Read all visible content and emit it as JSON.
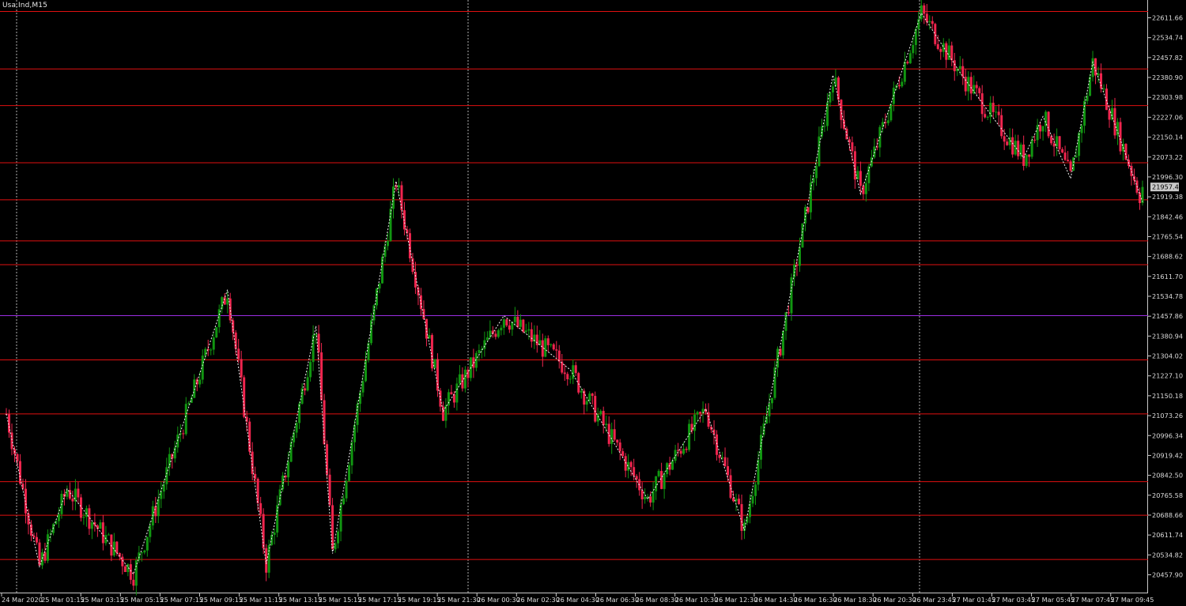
{
  "symbol": "Usa.Ind,M15",
  "colors": {
    "background": "#000000",
    "bull": "#119611",
    "bear": "#f0254e",
    "level_line": "#e01010",
    "mid_line": "#9b2ee3",
    "zigzag": "#f2f2f2",
    "grid_v": "#cfcfcf",
    "axis_text": "#dcdcdc",
    "current_price_bg": "#c8c8c8"
  },
  "current_price": "21957.40",
  "chart_data": {
    "type": "candlestick",
    "timeframe": "M15",
    "y_range": [
      20420,
      22640
    ],
    "price_ticks": [
      "22611.66",
      "22534.74",
      "22457.82",
      "22380.90",
      "22303.98",
      "22227.06",
      "22150.14",
      "22073.22",
      "21996.30",
      "21919.38",
      "21842.46",
      "21765.54",
      "21688.62",
      "21611.70",
      "21534.78",
      "21457.86",
      "21380.94",
      "21304.02",
      "21227.10",
      "21150.18",
      "21073.26",
      "20996.34",
      "20919.42",
      "20842.50",
      "20765.58",
      "20688.66",
      "20611.74",
      "20534.82",
      "20457.90"
    ],
    "time_ticks": [
      "24 Mar 2020",
      "25 Mar 01:15",
      "25 Mar 03:15",
      "25 Mar 05:15",
      "25 Mar 07:15",
      "25 Mar 09:15",
      "25 Mar 11:15",
      "25 Mar 13:15",
      "25 Mar 15:15",
      "25 Mar 17:15",
      "25 Mar 19:15",
      "25 Mar 21:30",
      "26 Mar 00:30",
      "26 Mar 02:30",
      "26 Mar 04:30",
      "26 Mar 06:30",
      "26 Mar 08:30",
      "26 Mar 10:30",
      "26 Mar 12:30",
      "26 Mar 14:30",
      "26 Mar 16:30",
      "26 Mar 18:30",
      "26 Mar 20:30",
      "26 Mar 23:45",
      "27 Mar 01:45",
      "27 Mar 03:45",
      "27 Mar 05:45",
      "27 Mar 07:45",
      "27 Mar 09:45"
    ],
    "day_separators": [
      "25 Mar 00:00",
      "26 Mar 00:00",
      "27 Mar 00:00"
    ],
    "level_lines": [
      22636,
      22414,
      22272,
      22051,
      21908,
      21749,
      21657,
      21460,
      21289,
      21080,
      20818,
      20688,
      20517
    ],
    "mid_line": 21460,
    "zigzag": [
      [
        0,
        21080
      ],
      [
        12,
        20490
      ],
      [
        22,
        20790
      ],
      [
        46,
        20460
      ],
      [
        80,
        21560
      ],
      [
        94,
        20500
      ],
      [
        112,
        21420
      ],
      [
        118,
        20540
      ],
      [
        141,
        21980
      ],
      [
        158,
        21090
      ],
      [
        180,
        21460
      ],
      [
        204,
        21250
      ],
      [
        232,
        20750
      ],
      [
        253,
        21100
      ],
      [
        267,
        20630
      ],
      [
        299,
        22390
      ],
      [
        309,
        21930
      ],
      [
        331,
        22630
      ],
      [
        345,
        22400
      ],
      [
        358,
        22210
      ],
      [
        368,
        22070
      ],
      [
        375,
        22230
      ],
      [
        385,
        21990
      ],
      [
        393,
        22440
      ],
      [
        411,
        21900
      ]
    ],
    "candle_count": 412,
    "last_close": 21957.4
  }
}
